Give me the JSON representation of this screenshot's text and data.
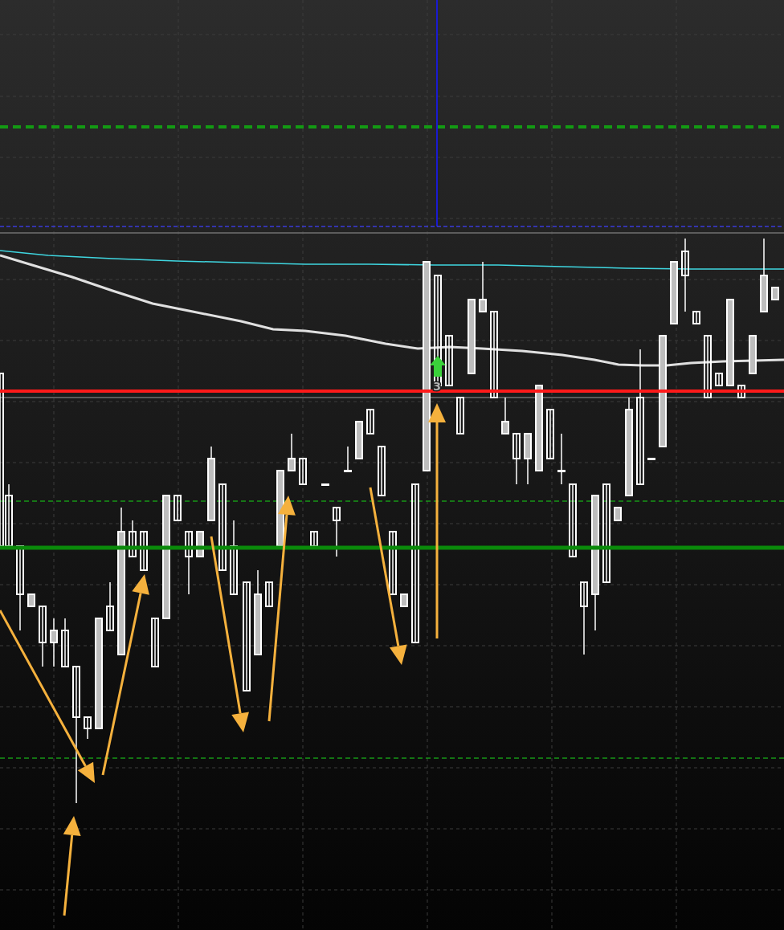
{
  "chart": {
    "signal_marker": {
      "label": "3"
    }
  }
}
